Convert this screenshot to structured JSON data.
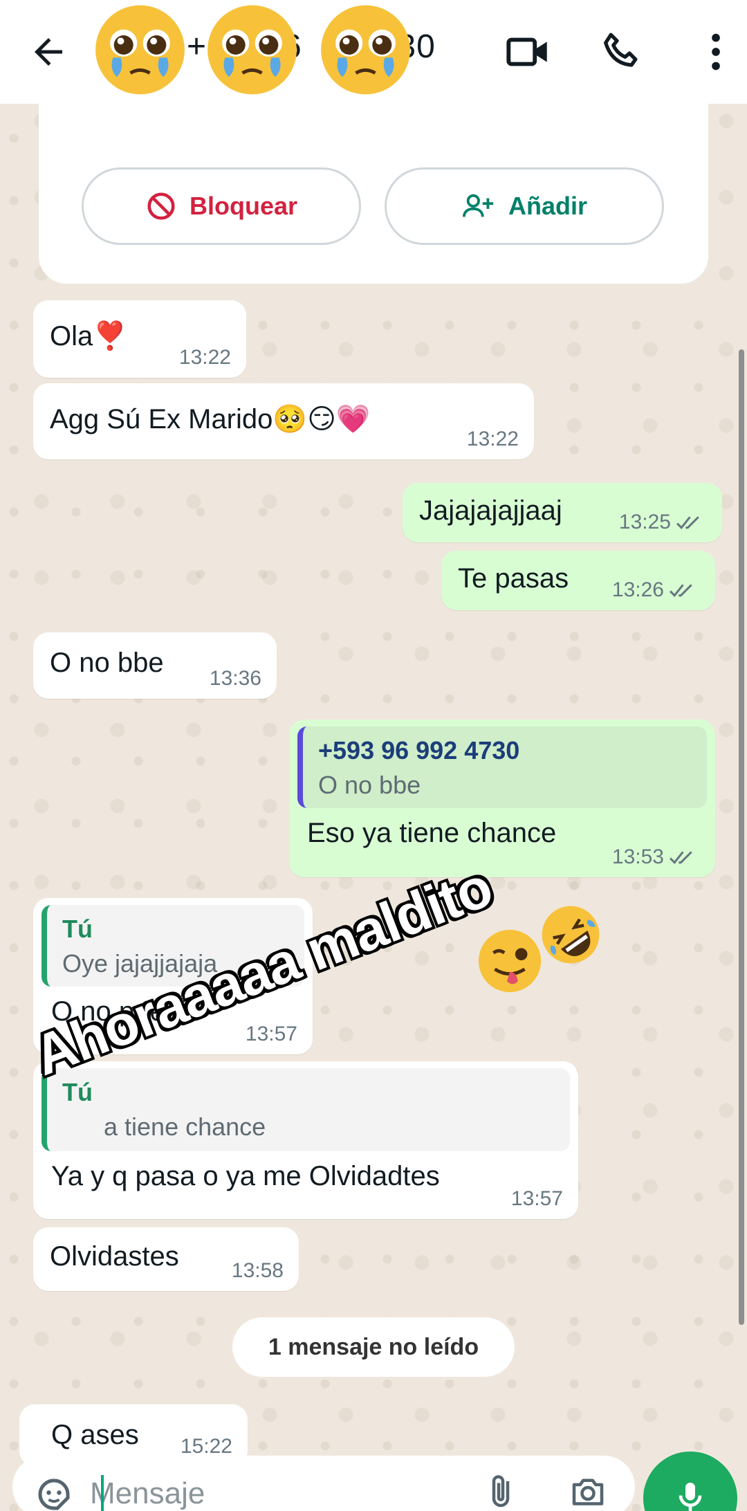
{
  "header": {
    "title_visible": "+",
    "title_fragment_1": "6",
    "title_fragment_2": "730",
    "icons": [
      "back-arrow-icon",
      "pleading-face-emoji",
      "video-call-icon",
      "phone-icon",
      "more-vert-icon"
    ]
  },
  "contact_card": {
    "block_label": "Bloquear",
    "add_label": "Añadir"
  },
  "messages": [
    {
      "side": "in",
      "text": "Ola❣️",
      "time": "13:22"
    },
    {
      "side": "in",
      "text": "Agg Sú Ex Marido🥺😏💗",
      "time": "13:22"
    },
    {
      "side": "out",
      "text": "Jajajajajjaaj",
      "time": "13:25"
    },
    {
      "side": "out",
      "text": "Te pasas",
      "time": "13:26"
    },
    {
      "side": "in",
      "text": "O no bbe",
      "time": "13:36"
    },
    {
      "side": "out",
      "quote_author": "+593 96 992 4730",
      "quote_text": "O no bbe",
      "text": "Eso ya tiene chance",
      "time": "13:53"
    },
    {
      "side": "in",
      "quote_author": "Tú",
      "quote_text": "Oye jajajjajaja",
      "text": "O no puedo",
      "time": "13:57"
    },
    {
      "side": "in",
      "quote_author": "Tú",
      "quote_text": "a tiene chance",
      "text": "Ya y q pasa o ya me Olvidadtes",
      "time": "13:57"
    },
    {
      "side": "in",
      "text": "Olvidastes",
      "time": "13:58"
    },
    {
      "side": "in",
      "text": "Q ases",
      "time": "15:22"
    }
  ],
  "unread_label": "1 mensaje no leído",
  "overlay_text": "Ahoraaaaa maldito",
  "input": {
    "placeholder": "Mensaje"
  },
  "colors": {
    "outgoing": "#d9fdd3",
    "incoming": "#ffffff",
    "accent": "#1daa61",
    "block": "#d4213f",
    "add": "#008069"
  }
}
